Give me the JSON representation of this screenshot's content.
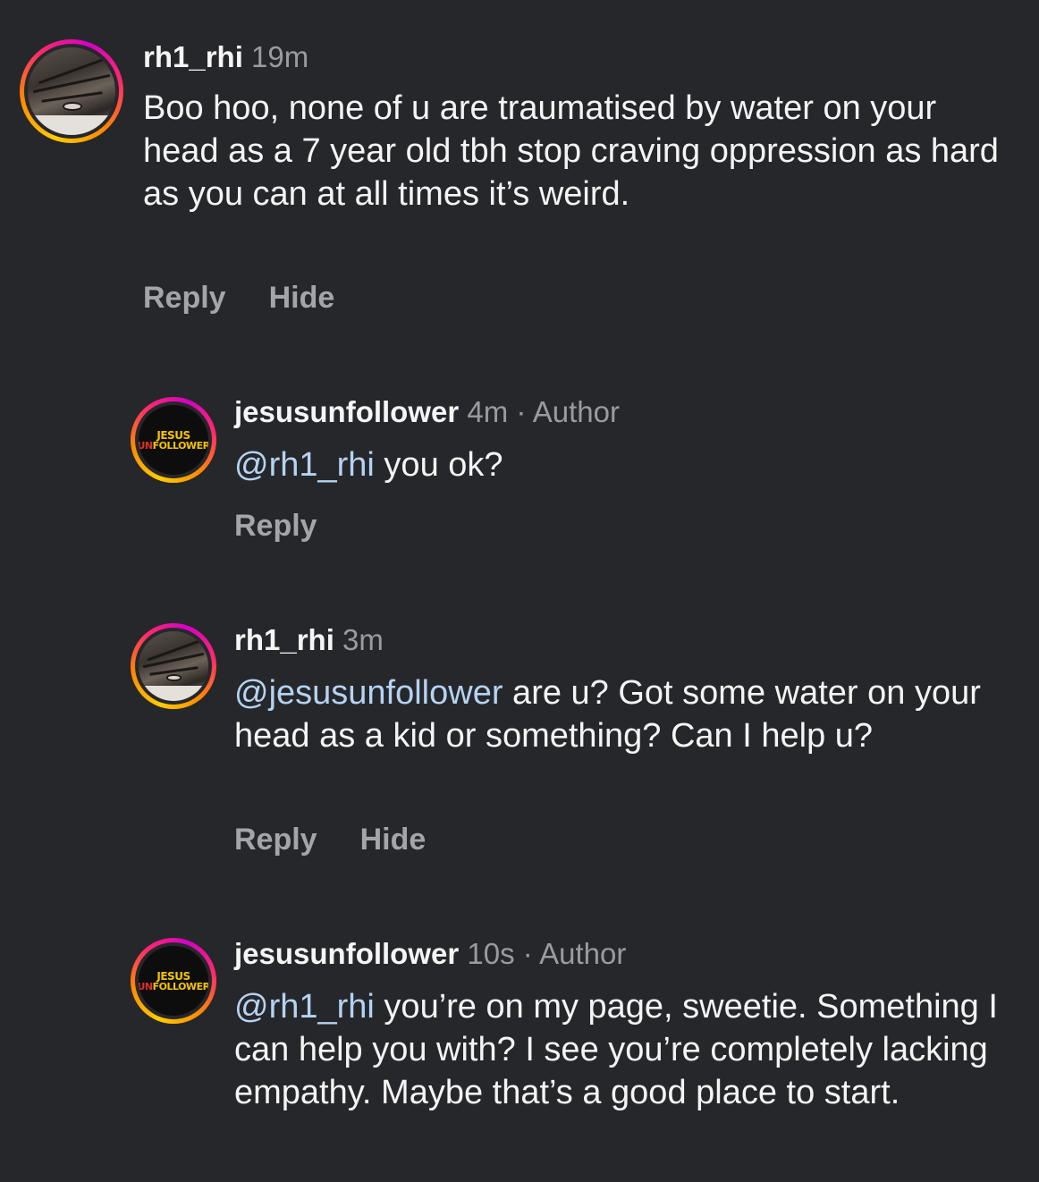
{
  "comments": [
    {
      "username": "rh1_rhi",
      "time": "19m",
      "author_badge": "",
      "mention": "",
      "text": "Boo hoo, none of u are traumatised by water on your head as a 7 year old tbh stop craving oppression as hard as you can at all times it’s weird.",
      "actions": [
        "Reply",
        "Hide"
      ]
    },
    {
      "username": "jesusunfollower",
      "time": "4m",
      "separator": "·",
      "author_badge": "Author",
      "mention": "@rh1_rhi",
      "text": " you ok?",
      "actions": [
        "Reply"
      ]
    },
    {
      "username": "rh1_rhi",
      "time": "3m",
      "author_badge": "",
      "mention": "@jesusunfollower",
      "text": " are u? Got some water on your head as a kid or something? Can I help u?",
      "actions": [
        "Reply",
        "Hide"
      ]
    },
    {
      "username": "jesusunfollower",
      "time": "10s",
      "separator": "·",
      "author_badge": "Author",
      "mention": "@rh1_rhi",
      "text": " you’re on my page, sweetie. Something I can help you with? I see you’re completely lacking empathy. Maybe that’s a good place to start.",
      "actions": []
    }
  ],
  "logo": {
    "line1": "JESUS",
    "line2_prefix": "UN",
    "line2_rest": "FOLLOWER"
  },
  "colors": {
    "background": "#26272b",
    "mention": "#b5d3f2",
    "secondary_text": "#9a9ba1"
  }
}
